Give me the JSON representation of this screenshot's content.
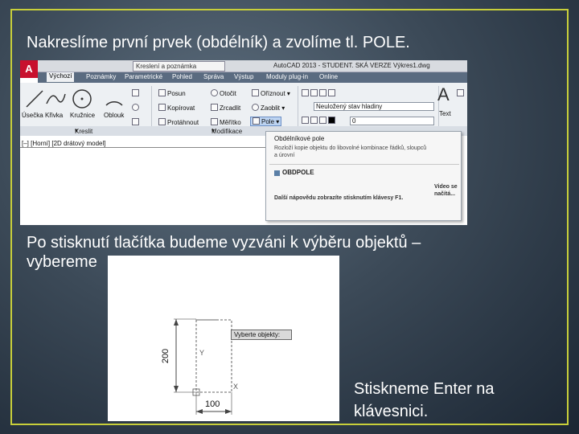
{
  "slide": {
    "text_top": "Nakreslíme první prvek (obdélník) a zvolíme tl. POLE.",
    "text_mid_line1": "Po stisknutí tlačítka budeme vyzváni k výběru objektů –",
    "text_mid_line2": "vybereme",
    "text_bottom_line1": "Stiskneme Enter na",
    "text_bottom_line2": "klávesnici."
  },
  "colors": {
    "frame_border": "#c8cf3a",
    "active_button": "#bcd3f1",
    "app_logo": "#c8102e"
  },
  "autocad": {
    "logo_letter": "A",
    "workspace_dropdown": "Kreslení a poznámka",
    "app_title": "AutoCAD 2013 - STUDENT. SKÁ VERZE   Výkres1.dwg",
    "tabs": [
      "Výchozí",
      "Poznámky",
      "Parametrické",
      "Pohled",
      "Správa",
      "Výstup",
      "Moduly plug-in",
      "Online"
    ],
    "draw_tools": [
      "Úsečka",
      "Křivka",
      "Kružnice",
      "Oblouk"
    ],
    "modify_tools": {
      "col1": [
        "Posun",
        "Kopírovat",
        "Protáhnout"
      ],
      "col2": [
        "Otočit",
        "Zrcadlit",
        "Měřítko"
      ],
      "col3": [
        "Oříznout",
        "Zaoblit",
        "Pole"
      ]
    },
    "layer_dropdown": "Neuložený stav hladiny",
    "layer_value": "0",
    "text_button": "Text",
    "text_letter": "A",
    "panel_labels": [
      "Kreslit",
      "Modifikace"
    ],
    "view_label": "[–] [Horní] [2D drátový model]",
    "tooltip": {
      "heading": "Obdélníkové pole",
      "description": "Rozloží kopie objektu do libovolné kombinace řádků, sloupců a úrovní",
      "command": "OBDPOLE",
      "help": "Další nápovědu zobrazíte stisknutím klávesy F1.",
      "video": "Video se načítá..."
    }
  },
  "drawing": {
    "prompt": "Vyberte objekty:",
    "dim_vertical": "200",
    "dim_horizontal": "100",
    "axis_y": "Y",
    "axis_x": "X"
  }
}
